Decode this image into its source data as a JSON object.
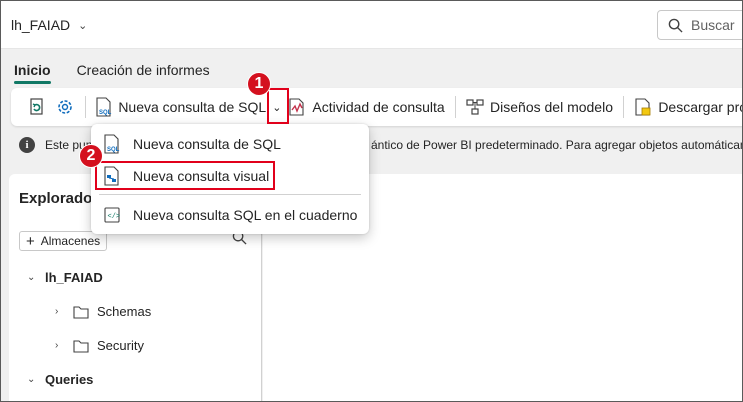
{
  "header": {
    "workspace_title": "lh_FAIAD",
    "search_placeholder": "Buscar"
  },
  "tabs": [
    {
      "label": "Inicio",
      "active": true
    },
    {
      "label": "Creación de informes",
      "active": false
    }
  ],
  "ribbon": {
    "new_sql_query_label": "Nueva consulta de SQL",
    "query_activity_label": "Actividad de consulta",
    "model_designs_label": "Diseños del modelo",
    "download_label": "Descargar pro"
  },
  "infobar": {
    "left_text": "Este pun",
    "right_text": "ántico de Power BI predeterminado. Para agregar objetos automáticam"
  },
  "dropdown": {
    "items": [
      {
        "label": "Nueva consulta de SQL",
        "icon": "sql-file-icon"
      },
      {
        "label": "Nueva consulta visual",
        "icon": "visual-query-icon"
      },
      {
        "label": "Nueva consulta SQL en el cuaderno",
        "icon": "notebook-code-icon"
      }
    ]
  },
  "explorer": {
    "title": "Explorado",
    "warehouses_button": "Almacenes",
    "tree": [
      {
        "label": "lh_FAIAD",
        "level": 0,
        "expanded": true
      },
      {
        "label": "Schemas",
        "level": 1,
        "expanded": false
      },
      {
        "label": "Security",
        "level": 1,
        "expanded": false
      },
      {
        "label": "Queries",
        "level": 0,
        "expanded": true
      }
    ]
  },
  "callouts": {
    "step1": "1",
    "step2": "2",
    "color": "#d4101e"
  },
  "colors": {
    "accent": "#117865",
    "callout_border": "#e1001b"
  }
}
